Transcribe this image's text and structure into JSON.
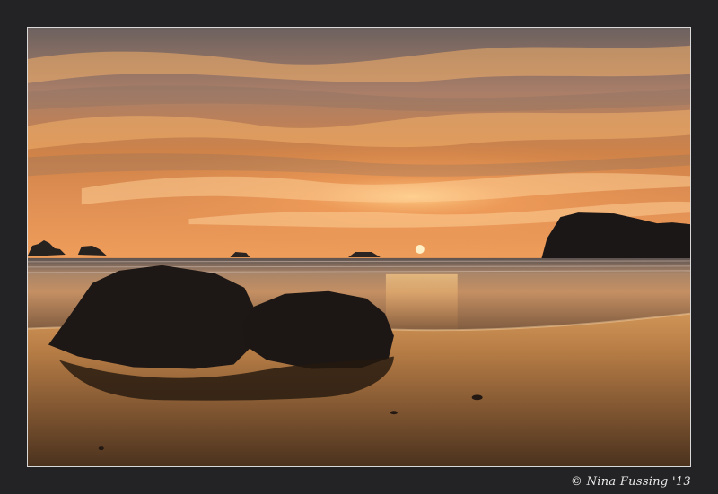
{
  "photo": {
    "credit": "© Nina Fussing '13"
  },
  "colors": {
    "frame": "#232325",
    "border": "#d9d9d9",
    "sky_top": "#6f625f",
    "sky_mid": "#c67d48",
    "sky_horizon": "#e69452",
    "sun": "#ffd88a",
    "sea": "#b97a4d",
    "sand": "#6d4628",
    "rock": "#1b1615"
  }
}
